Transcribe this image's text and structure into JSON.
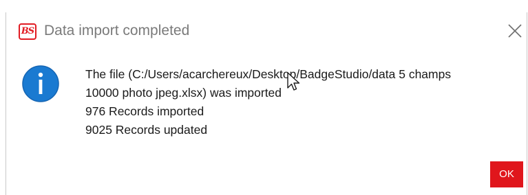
{
  "dialog": {
    "app_icon_text": "BS",
    "title": "Data import completed",
    "close_icon": "close-icon",
    "info_icon": "info-icon",
    "message_lines": [
      "The file (C:/Users/acarchereux/Desktop/BadgeStudio/data 5 champs",
      "10000 photo jpeg.xlsx) was imported",
      "976 Records imported",
      "9025 Records updated"
    ],
    "ok_label": "OK"
  },
  "colors": {
    "accent": "#e0161c",
    "info_blue": "#1a7ad1",
    "title_gray": "#7a7a7a"
  }
}
